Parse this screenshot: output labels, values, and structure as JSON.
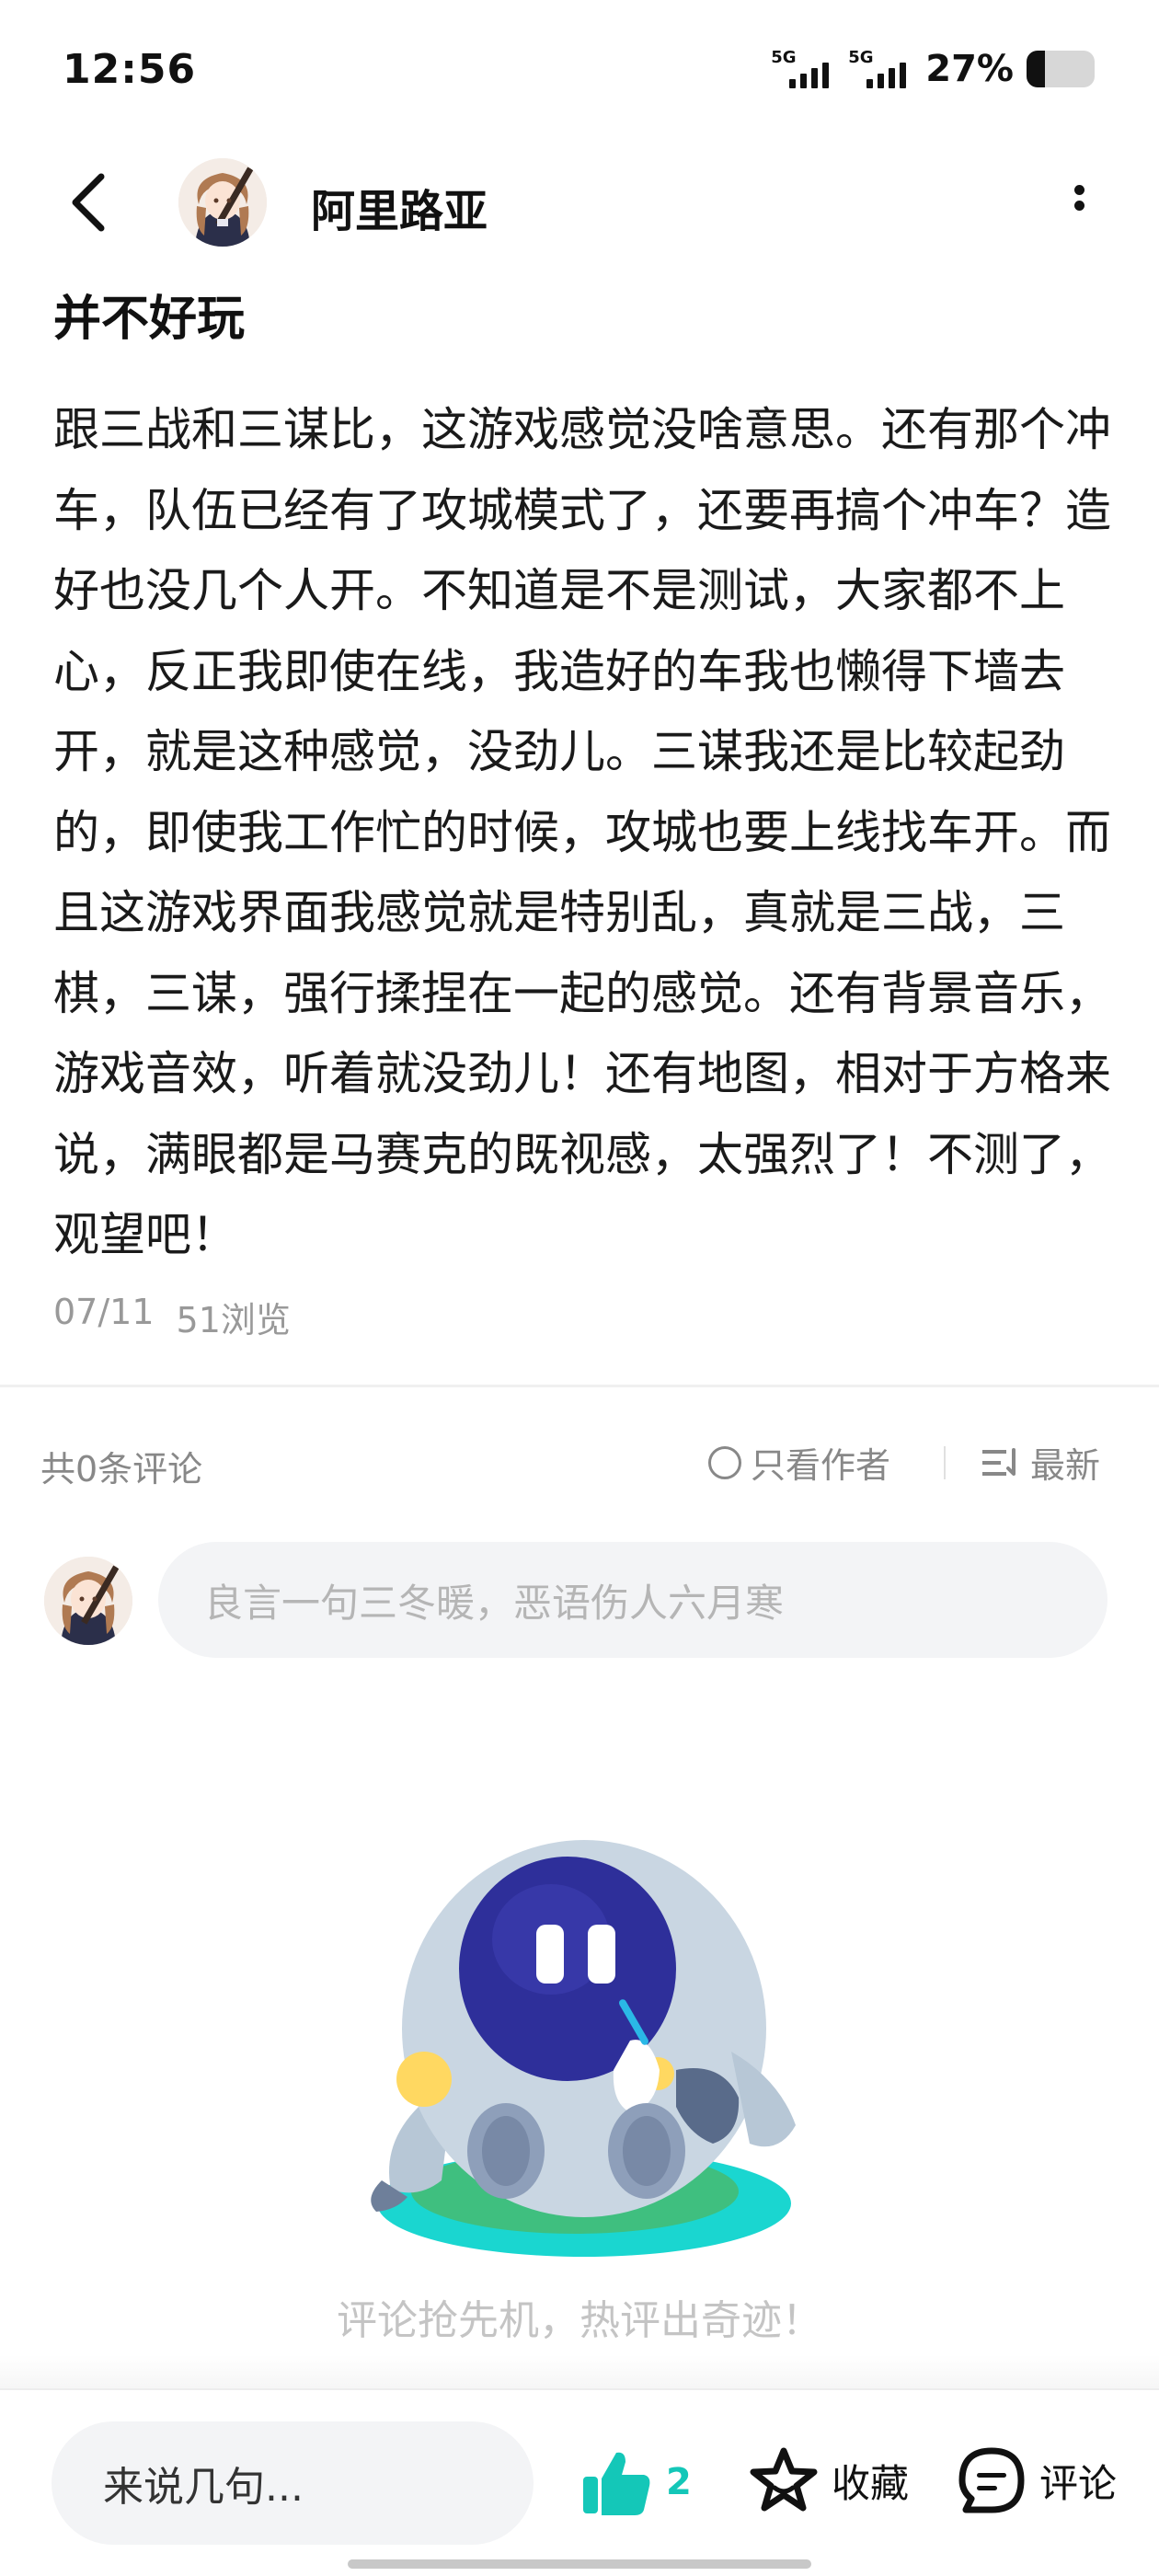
{
  "status_bar": {
    "time": "12:56",
    "signal_1_tag": "5G",
    "signal_2_tag": "5G",
    "battery_percent": "27%",
    "battery_level": 0.27
  },
  "header": {
    "author_name": "阿里路亚",
    "back_icon": "chevron-left-icon",
    "more_icon": "more-vertical-icon"
  },
  "post": {
    "title": "并不好玩",
    "body": "跟三战和三谋比，这游戏感觉没啥意思。还有那个冲车，队伍已经有了攻城模式了，还要再搞个冲车？造好也没几个人开。不知道是不是测试，大家都不上心，反正我即使在线，我造好的车我也懒得下墙去开，就是这种感觉，没劲儿。三谋我还是比较起劲的，即使我工作忙的时候，攻城也要上线找车开。而且这游戏界面我感觉就是特别乱，真就是三战，三棋，三谋，强行揉捏在一起的感觉。还有背景音乐，游戏音效，听着就没劲儿！还有地图，相对于方格来说，满眼都是马赛克的既视感，太强烈了！不测了，观望吧！",
    "date": "07/11",
    "views": "51浏览"
  },
  "comments": {
    "count_label": "共0条评论",
    "author_only_label": "只看作者",
    "sort_label": "最新",
    "input_placeholder": "良言一句三冬暖，恶语伤人六月寒",
    "empty_text": "评论抢先机，热评出奇迹！"
  },
  "bottom_bar": {
    "input_placeholder": "来说几句...",
    "like_count": "2",
    "favorite_label": "收藏",
    "comment_label": "评论"
  },
  "colors": {
    "accent": "#14c7b8",
    "text_primary": "#1a1a1a",
    "text_secondary": "#888888",
    "input_bg": "#f3f4f6"
  }
}
